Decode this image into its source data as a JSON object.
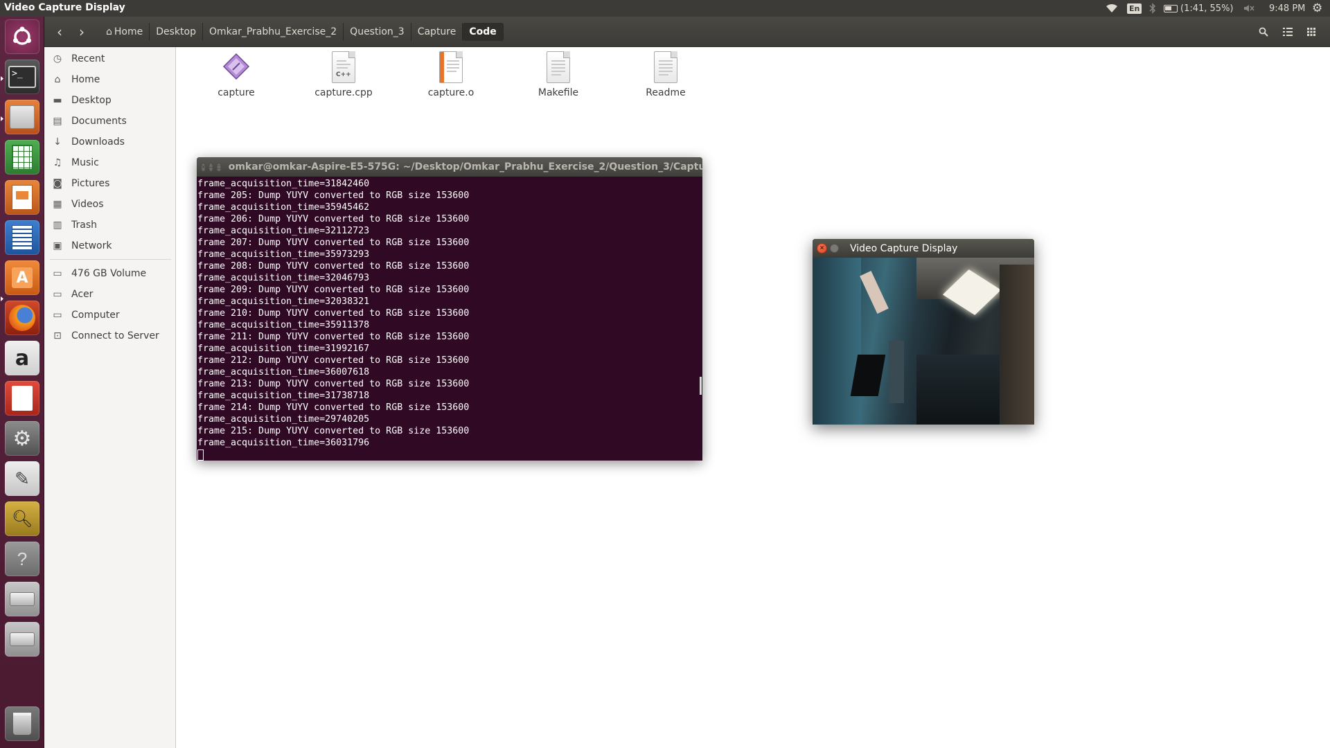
{
  "top_panel": {
    "title": "Video Capture Display",
    "language": "En",
    "battery": "(1:41, 55%)",
    "time": "9:48 PM"
  },
  "launcher": {
    "items": [
      "dash-home",
      "terminal",
      "files-manager",
      "libreoffice-calc",
      "libreoffice-impress",
      "libreoffice-writer",
      "ubuntu-software-center",
      "firefox",
      "amazon",
      "pdf-viewer",
      "system-settings",
      "text-editor",
      "image-viewer",
      "help",
      "drive-1",
      "drive-2",
      "trash"
    ]
  },
  "file_manager": {
    "breadcrumbs": [
      "Home",
      "Desktop",
      "Omkar_Prabhu_Exercise_2",
      "Question_3",
      "Capture",
      "Code"
    ],
    "active_crumb": "Code",
    "sidebar": [
      {
        "label": "Recent",
        "icon": "clock-icon"
      },
      {
        "label": "Home",
        "icon": "home-icon"
      },
      {
        "label": "Desktop",
        "icon": "folder-icon"
      },
      {
        "label": "Documents",
        "icon": "document-icon"
      },
      {
        "label": "Downloads",
        "icon": "download-icon"
      },
      {
        "label": "Music",
        "icon": "music-icon"
      },
      {
        "label": "Pictures",
        "icon": "camera-icon"
      },
      {
        "label": "Videos",
        "icon": "film-icon"
      },
      {
        "label": "Trash",
        "icon": "trash-icon"
      },
      {
        "label": "Network",
        "icon": "network-icon"
      },
      {
        "label": "476 GB Volume",
        "icon": "drive-icon"
      },
      {
        "label": "Acer",
        "icon": "drive-icon"
      },
      {
        "label": "Computer",
        "icon": "computer-icon"
      },
      {
        "label": "Connect to Server",
        "icon": "server-icon"
      }
    ],
    "files": [
      {
        "name": "capture",
        "type": "executable"
      },
      {
        "name": "capture.cpp",
        "type": "cpp-source",
        "badge": "C++"
      },
      {
        "name": "capture.o",
        "type": "object"
      },
      {
        "name": "Makefile",
        "type": "text"
      },
      {
        "name": "Readme",
        "type": "text"
      }
    ]
  },
  "terminal": {
    "title": "omkar@omkar-Aspire-E5-575G: ~/Desktop/Omkar_Prabhu_Exercise_2/Question_3/Captu",
    "lines": [
      "frame_acquisition_time=31842460",
      "frame 205: Dump YUYV converted to RGB size 153600",
      "frame_acquisition_time=35945462",
      "frame 206: Dump YUYV converted to RGB size 153600",
      "frame_acquisition_time=32112723",
      "frame 207: Dump YUYV converted to RGB size 153600",
      "frame_acquisition_time=35973293",
      "frame 208: Dump YUYV converted to RGB size 153600",
      "frame_acquisition_time=32046793",
      "frame 209: Dump YUYV converted to RGB size 153600",
      "frame_acquisition_time=32038321",
      "frame 210: Dump YUYV converted to RGB size 153600",
      "frame_acquisition_time=35911378",
      "frame 211: Dump YUYV converted to RGB size 153600",
      "frame_acquisition_time=31992167",
      "frame 212: Dump YUYV converted to RGB size 153600",
      "frame_acquisition_time=36007618",
      "frame 213: Dump YUYV converted to RGB size 153600",
      "frame_acquisition_time=31738718",
      "frame 214: Dump YUYV converted to RGB size 153600",
      "frame_acquisition_time=29740205",
      "frame 215: Dump YUYV converted to RGB size 153600",
      "frame_acquisition_time=36031796"
    ]
  },
  "video_window": {
    "title": "Video Capture Display"
  },
  "colors": {
    "panel": "#3c3b37",
    "launcher": "#5c2640",
    "terminal_bg": "#300a24",
    "sidebar_bg": "#f5f4f2",
    "close_button": "#e9532c"
  }
}
